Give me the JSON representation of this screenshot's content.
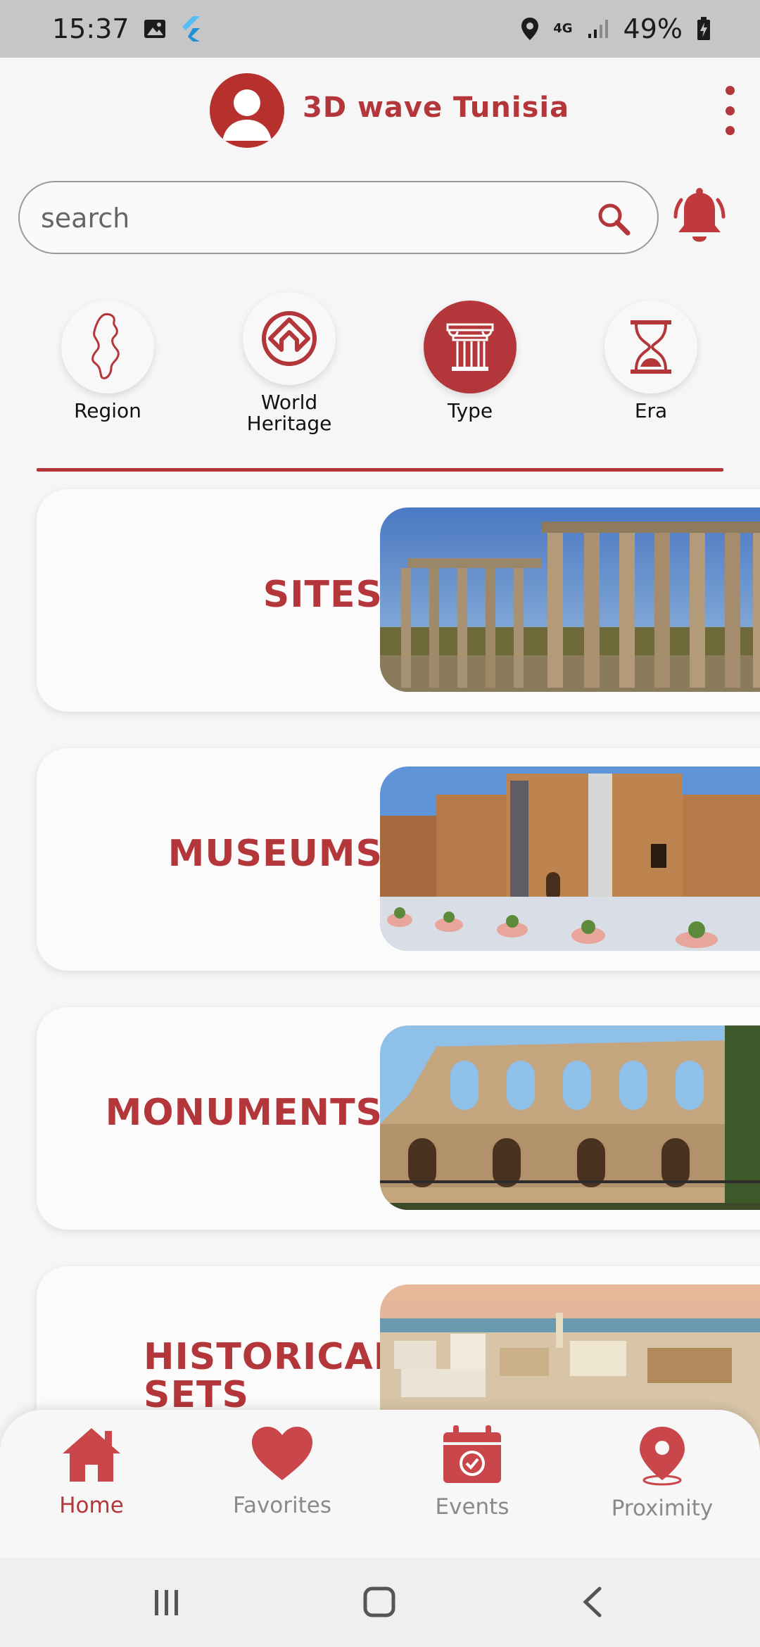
{
  "status_bar": {
    "time": "15:37",
    "network": "4G",
    "battery": "49%"
  },
  "header": {
    "title": "3D wave Tunisia"
  },
  "search": {
    "placeholder": "search"
  },
  "filters": [
    {
      "label": "Region",
      "icon": "tunisia-map-icon",
      "active": false
    },
    {
      "label": "World Heritage",
      "icon": "world-heritage-icon",
      "active": false
    },
    {
      "label": "Type",
      "icon": "column-icon",
      "active": true
    },
    {
      "label": "Era",
      "icon": "hourglass-icon",
      "active": false
    }
  ],
  "categories": [
    {
      "label": "SITES",
      "image": "roman-columns-photo"
    },
    {
      "label": "MUSEUMS",
      "image": "fortress-museum-photo"
    },
    {
      "label": "MONUMENTS",
      "image": "amphitheatre-photo"
    },
    {
      "label": "HISTORICAL SETS",
      "image": "medina-city-photo"
    }
  ],
  "bottom_nav": [
    {
      "label": "Home",
      "icon": "home-icon",
      "active": true
    },
    {
      "label": "Favorites",
      "icon": "heart-icon",
      "active": false
    },
    {
      "label": "Events",
      "icon": "calendar-icon",
      "active": false
    },
    {
      "label": "Proximity",
      "icon": "location-pin-icon",
      "active": false
    }
  ],
  "colors": {
    "accent": "#b3363a",
    "inactive": "#8a8a8a",
    "background": "#f6f6f7"
  }
}
